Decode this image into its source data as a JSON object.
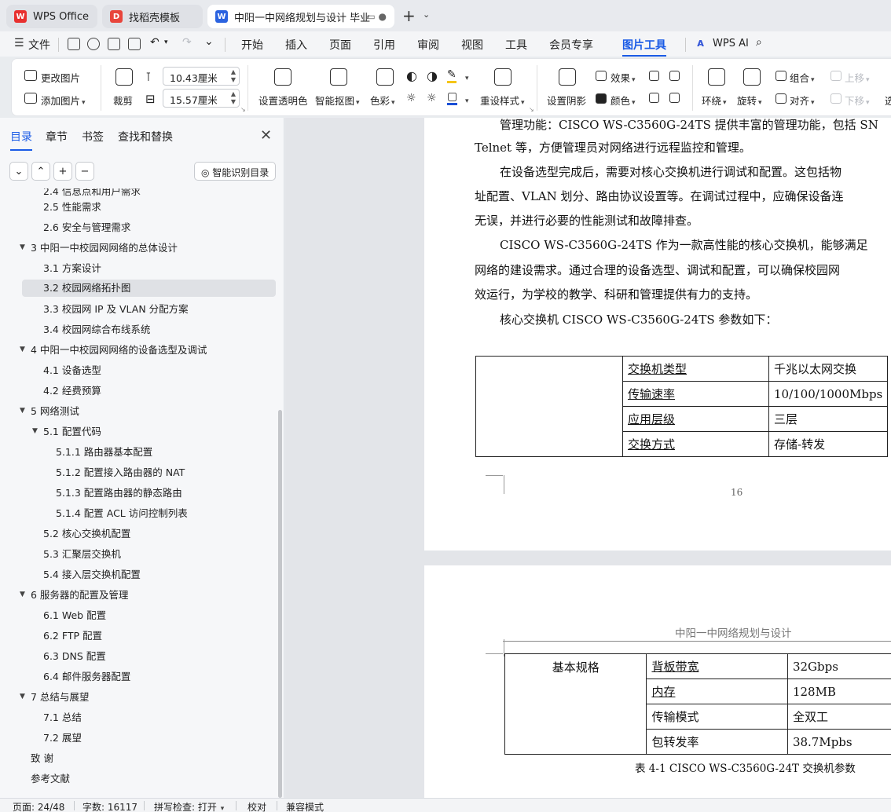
{
  "tabs": {
    "t1": "WPS Office",
    "t2": "找稻壳模板",
    "t3": "中阳一中网络规划与设计 毕业",
    "new_tab": "+"
  },
  "menu": {
    "file": "文件",
    "items": [
      "开始",
      "插入",
      "页面",
      "引用",
      "审阅",
      "视图",
      "工具",
      "会员专享",
      "图片工具"
    ],
    "wps_ai": "WPS AI"
  },
  "ribbon": {
    "change_pic": "更改图片",
    "add_pic": "添加图片",
    "crop": "裁剪",
    "width": "10.43厘米",
    "height": "15.57厘米",
    "set_transparent": "设置透明色",
    "smart_cutout": "智能抠图",
    "color": "色彩",
    "reset_style": "重设样式",
    "set_shadow": "设置阴影",
    "effect": "效果",
    "fill_color": "颜色",
    "wrap": "环绕",
    "rotate": "旋转",
    "group": "组合",
    "align": "对齐",
    "move_up": "上移",
    "move_down": "下移",
    "select": "选"
  },
  "nav": {
    "tabs": [
      "目录",
      "章节",
      "书签",
      "查找和替换"
    ],
    "smart_toc": "智能识别目录",
    "toc": [
      "2.4 信息点和用户需求",
      "2.5 性能需求",
      "2.6 安全与管理需求",
      "3 中阳一中校园网网络的总体设计",
      "3.1 方案设计",
      "3.2 校园网络拓扑图",
      "3.3 校园网 IP 及 VLAN 分配方案",
      "3.4 校园网综合布线系统",
      "4 中阳一中校园网网络的设备选型及调试",
      "4.1 设备选型",
      "4.2 经费预算",
      "5 网络测试",
      "5.1 配置代码",
      "5.1.1 路由器基本配置",
      "5.1.2 配置接入路由器的 NAT",
      "5.1.3 配置路由器的静态路由",
      "5.1.4 配置 ACL 访问控制列表",
      "5.2 核心交换机配置",
      "5.3 汇聚层交换机",
      "5.4 接入层交换机配置",
      "6 服务器的配置及管理",
      "6.1 Web 配置",
      "6.2 FTP 配置",
      "6.3 DNS 配置",
      "6.4 邮件服务器配置",
      "7 总结与展望",
      "7.1 总结",
      "7.2 展望",
      "致 谢",
      "参考文献"
    ]
  },
  "doc": {
    "p1a": "管理功能：CISCO WS-C3560G-24TS 提供丰富的管理功能，包括 SN",
    "p1b": "Telnet 等，方便管理员对网络进行远程监控和管理。",
    "p2a": "在设备选型完成后，需要对核心交换机进行调试和配置。这包括物",
    "p2b": "址配置、VLAN 划分、路由协议设置等。在调试过程中，应确保设备连",
    "p2c": "无误，并进行必要的性能测试和故障排查。",
    "p3a": "CISCO WS-C3560G-24TS 作为一款高性能的核心交换机，能够满足",
    "p3b": "网络的建设需求。通过合理的设备选型、调试和配置，可以确保校园网",
    "p3c": "效运行，为学校的教学、科研和管理提供有力的支持。",
    "p4": "核心交换机 CISCO WS-C3560G-24TS 参数如下：",
    "table1": [
      [
        "交换机类型",
        "千兆以太网交换"
      ],
      [
        "传输速率",
        "10/100/1000Mbps"
      ],
      [
        "应用层级",
        "三层"
      ],
      [
        "交换方式",
        "存储-转发"
      ]
    ],
    "page_num": "16",
    "header2": "中阳一中网络规划与设计",
    "table2_group": "基本规格",
    "table2": [
      [
        "背板带宽",
        "32Gbps"
      ],
      [
        "内存",
        "128MB"
      ],
      [
        "传输模式",
        "全双工"
      ],
      [
        "包转发率",
        "38.7Mpbs"
      ]
    ],
    "caption": "表 4-1 CISCO WS-C3560G-24T 交换机参数"
  },
  "status": {
    "page": "页面: 24/48",
    "words": "字数: 16117",
    "spell": "拼写检查: 打开",
    "proof": "校对",
    "compat": "兼容模式"
  }
}
